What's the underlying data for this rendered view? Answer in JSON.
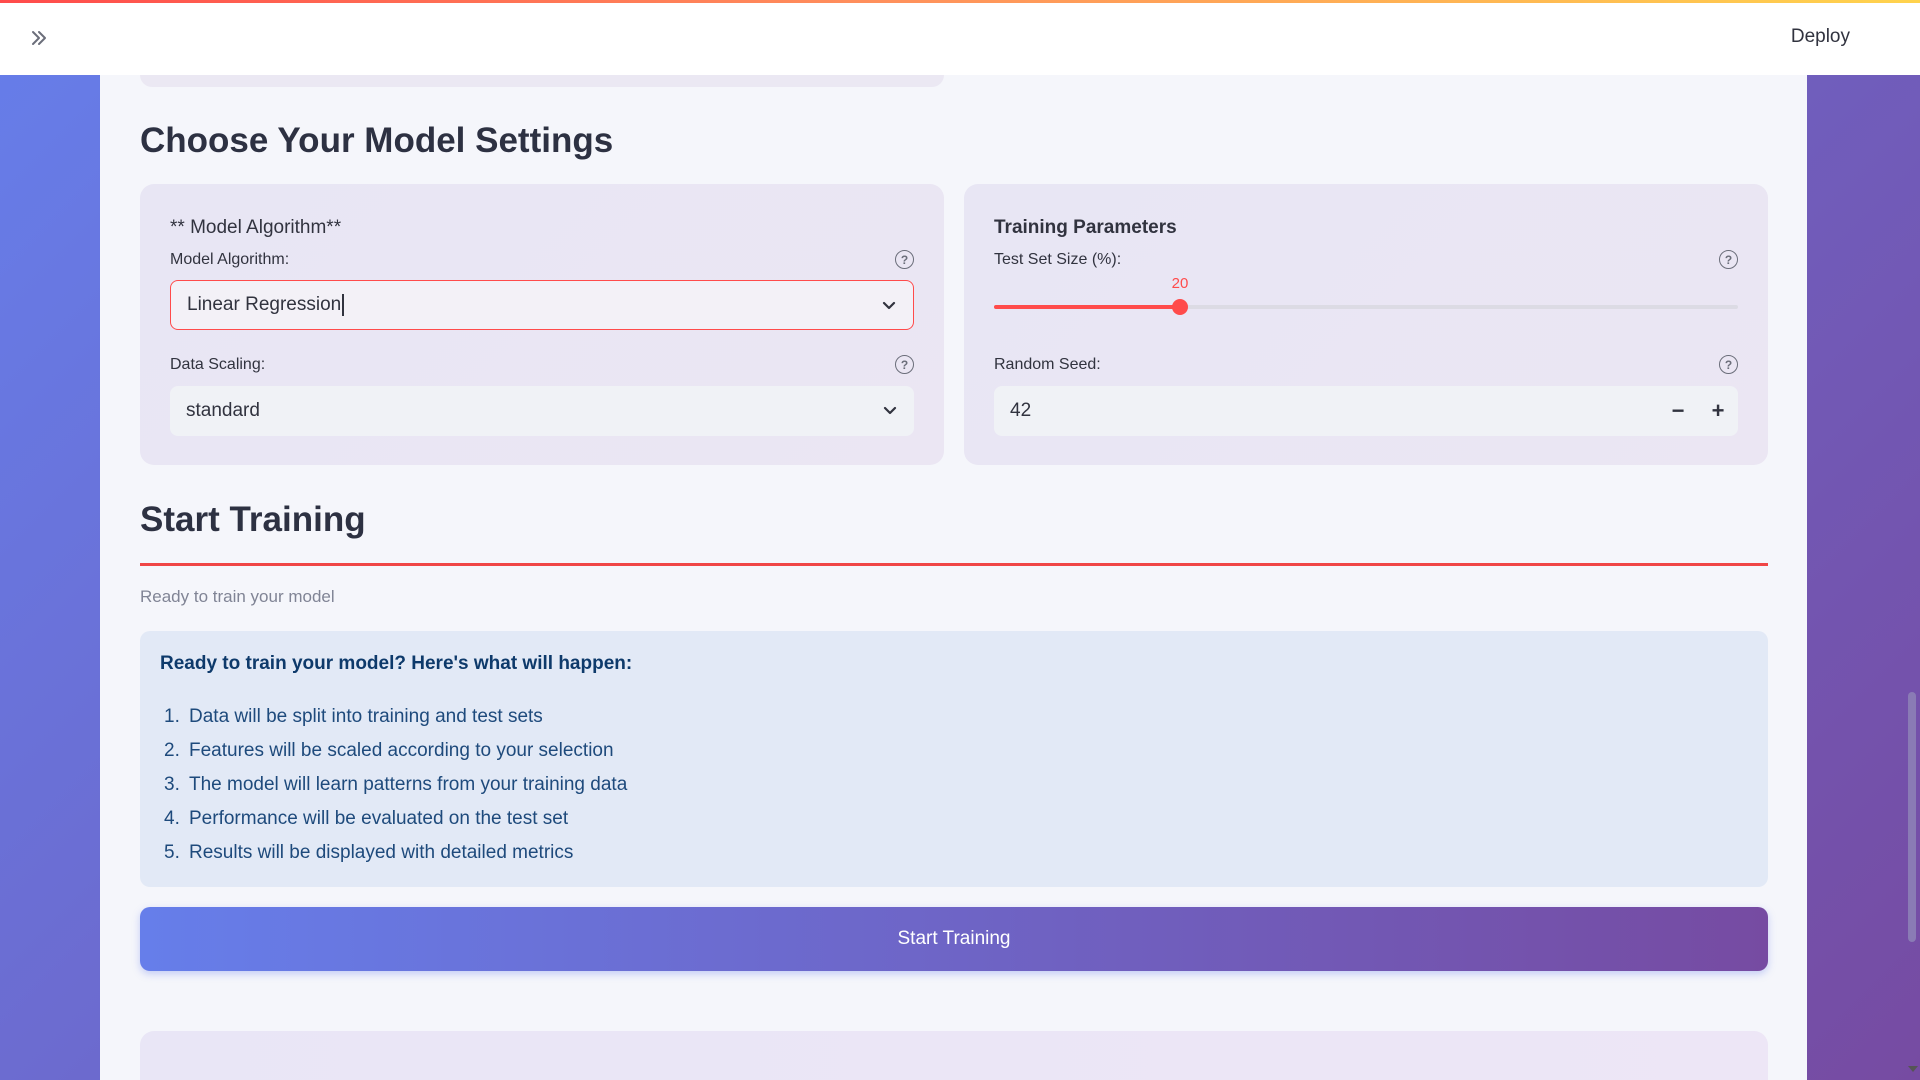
{
  "header": {
    "expand_icon": "double-chevron-right-icon",
    "deploy_label": "Deploy"
  },
  "settings": {
    "heading": "Choose Your Model Settings",
    "algorithm_card": {
      "title": "** Model Algorithm**",
      "algorithm_label": "Model Algorithm:",
      "algorithm_value": "Linear Regression",
      "scaling_label": "Data Scaling:",
      "scaling_value": "standard",
      "help_icon": "?"
    },
    "training_card": {
      "title": "Training Parameters",
      "test_size_label": "Test Set Size (%):",
      "test_size_value": "20",
      "test_size_fraction": 0.25,
      "seed_label": "Random Seed:",
      "seed_value": "42",
      "minus_label": "−",
      "plus_label": "+",
      "help_icon": "?"
    }
  },
  "training": {
    "heading": "Start Training",
    "caption": "Ready to train your model",
    "info_title": "Ready to train your model? Here's what will happen:",
    "steps": [
      {
        "num": "1.",
        "text": "Data will be split into training and test sets"
      },
      {
        "num": "2.",
        "text": "Features will be scaled according to your selection"
      },
      {
        "num": "3.",
        "text": "The model will learn patterns from your training data"
      },
      {
        "num": "4.",
        "text": "Performance will be evaluated on the test set"
      },
      {
        "num": "5.",
        "text": "Results will be displayed with detailed metrics"
      }
    ],
    "button_label": "Start Training"
  },
  "colors": {
    "accent": "#ff4b4b",
    "gradient_start": "#667eea",
    "gradient_end": "#764ba2"
  }
}
